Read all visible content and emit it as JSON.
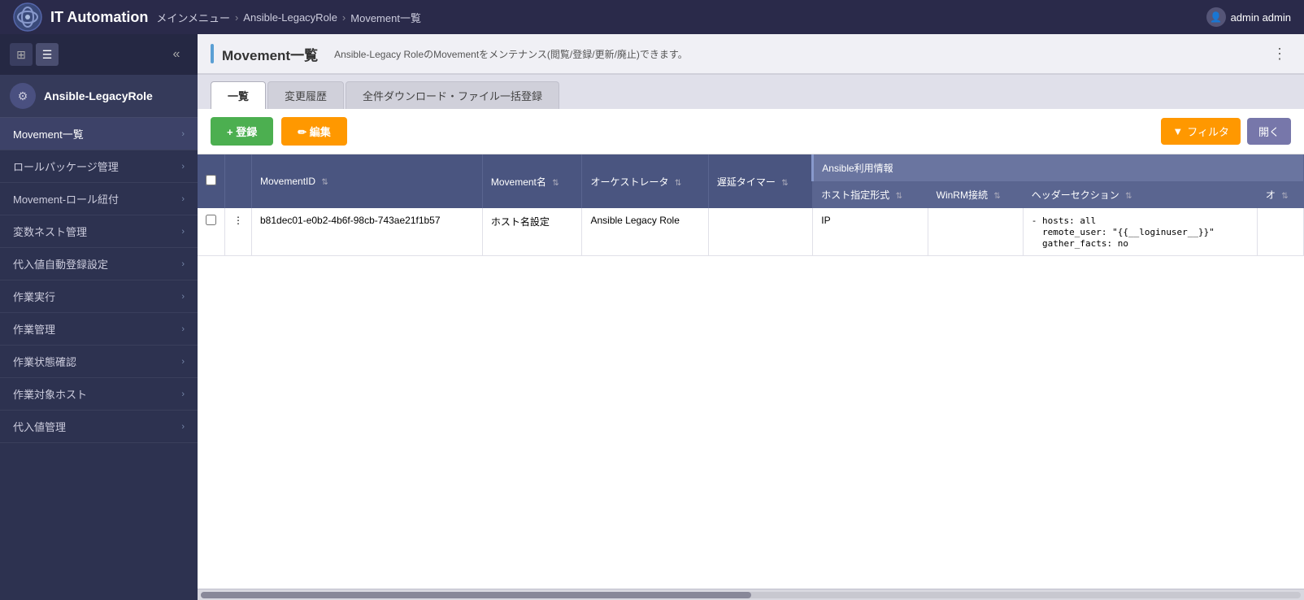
{
  "header": {
    "title": "IT Automation",
    "breadcrumb": [
      "メインメニュー",
      "Ansible-LegacyRole",
      "Movement一覧"
    ],
    "user": "admin admin"
  },
  "sidebar": {
    "section_label": "Ansible-LegacyRole",
    "toggle_btn1_label": "⊞",
    "toggle_btn2_label": "☰",
    "collapse_icon": "«",
    "items": [
      {
        "label": "Movement一覧",
        "active": true
      },
      {
        "label": "ロールパッケージ管理",
        "active": false
      },
      {
        "label": "Movement-ロール紐付",
        "active": false
      },
      {
        "label": "変数ネスト管理",
        "active": false
      },
      {
        "label": "代入値自動登録設定",
        "active": false
      },
      {
        "label": "作業実行",
        "active": false
      },
      {
        "label": "作業管理",
        "active": false
      },
      {
        "label": "作業状態確認",
        "active": false
      },
      {
        "label": "作業対象ホスト",
        "active": false
      },
      {
        "label": "代入値管理",
        "active": false
      }
    ]
  },
  "main": {
    "page_title": "Movement一覧",
    "page_desc": "Ansible-Legacy RoleのMovementをメンテナンス(閲覧/登録/更新/廃止)できます。",
    "tabs": [
      {
        "label": "一覧",
        "active": true
      },
      {
        "label": "変更履歴",
        "active": false
      },
      {
        "label": "全件ダウンロード・ファイル一括登録",
        "active": false
      }
    ],
    "btn_register": "+ 登録",
    "btn_edit": "✏ 編集",
    "btn_filter": "フィルタ",
    "btn_open": "開く",
    "table": {
      "columns": [
        {
          "label": "MovementID",
          "sortable": true
        },
        {
          "label": "Movement名",
          "sortable": true
        },
        {
          "label": "オーケストレータ",
          "sortable": true
        },
        {
          "label": "遅延タイマー",
          "sortable": true
        }
      ],
      "ansible_info_label": "Ansible利用情報",
      "ansible_columns": [
        {
          "label": "ホスト指定形式",
          "sortable": true
        },
        {
          "label": "WinRM接続",
          "sortable": true
        },
        {
          "label": "ヘッダーセクション",
          "sortable": true
        },
        {
          "label": "オ",
          "sortable": true
        }
      ],
      "rows": [
        {
          "id": "b81dec01-e0b2-4b6f-98cb-743ae21f1b57",
          "movement_name": "ホスト名設定",
          "orchestrator": "Ansible Legacy Role",
          "delay_timer": "",
          "host_format": "IP",
          "winrm": "",
          "header_section": "- hosts: all\n  remote_user: \"{{__loginuser__}}\"\n  gather_facts: no",
          "extra": ""
        }
      ]
    }
  }
}
